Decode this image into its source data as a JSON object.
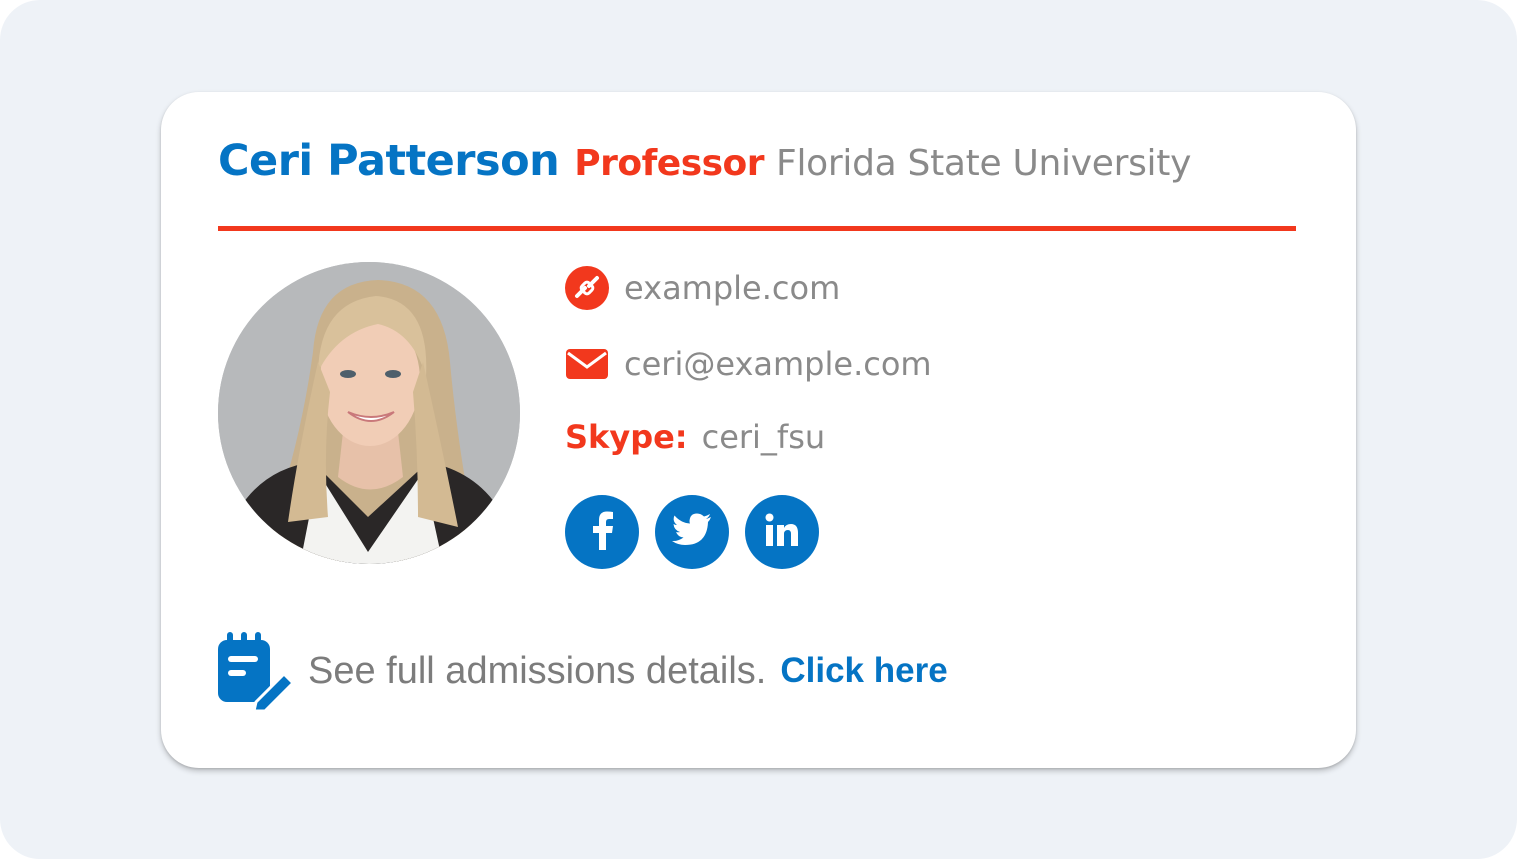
{
  "signature": {
    "name": "Ceri Patterson",
    "title": "Professor",
    "organization": "Florida State University",
    "website": "example.com",
    "email": "ceri@example.com",
    "skype_label": "Skype:",
    "skype_handle": "ceri_fsu",
    "socials": [
      {
        "icon": "facebook-icon"
      },
      {
        "icon": "twitter-icon"
      },
      {
        "icon": "linkedin-icon"
      }
    ],
    "footer_text": "See full admissions details.",
    "footer_link": "Click here"
  },
  "colors": {
    "background": "#eef2f7",
    "card": "#ffffff",
    "brand_blue": "#0574c4",
    "accent_red": "#f2381d",
    "text_gray": "#8a8a8a"
  }
}
